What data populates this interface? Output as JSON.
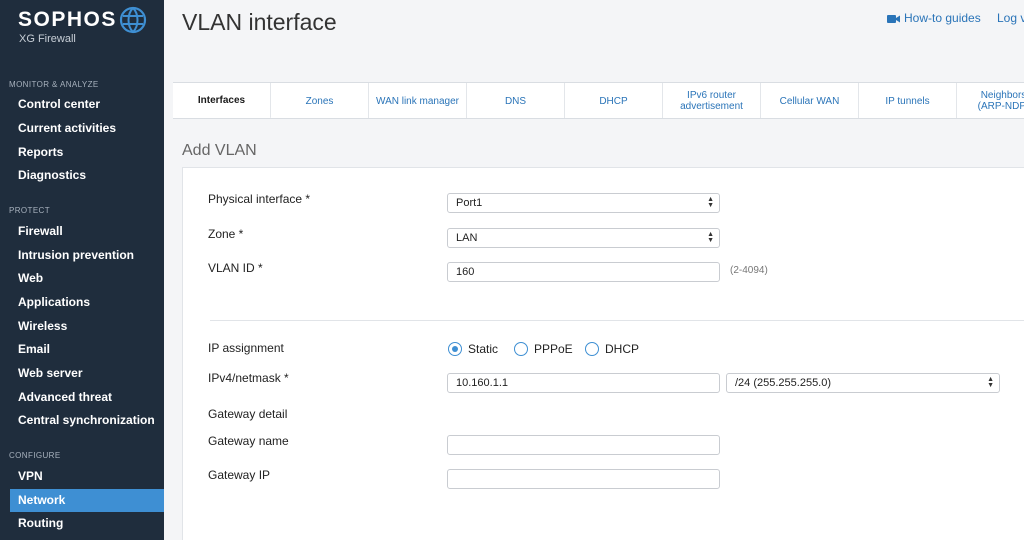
{
  "brand": {
    "name": "SOPHOS",
    "product": "XG Firewall"
  },
  "sidebar": {
    "sections": [
      {
        "title": "MONITOR & ANALYZE",
        "items": [
          "Control center",
          "Current activities",
          "Reports",
          "Diagnostics"
        ]
      },
      {
        "title": "PROTECT",
        "items": [
          "Firewall",
          "Intrusion prevention",
          "Web",
          "Applications",
          "Wireless",
          "Email",
          "Web server",
          "Advanced threat",
          "Central synchronization"
        ]
      },
      {
        "title": "CONFIGURE",
        "items": [
          "VPN",
          "Network",
          "Routing"
        ]
      }
    ],
    "active_item": "Network"
  },
  "header": {
    "title": "VLAN interface",
    "howto": "How-to guides",
    "log": "Log v"
  },
  "tabs": [
    {
      "label": "Interfaces",
      "active": true
    },
    {
      "label": "Zones"
    },
    {
      "label": "WAN link manager"
    },
    {
      "label": "DNS"
    },
    {
      "label": "DHCP"
    },
    {
      "label": "IPv6 router advertisement"
    },
    {
      "label": "Cellular WAN"
    },
    {
      "label": "IP tunnels"
    },
    {
      "label": "Neighbors (ARP-NDP)"
    }
  ],
  "form": {
    "section_title": "Add VLAN",
    "physical_interface": {
      "label": "Physical interface *",
      "value": "Port1"
    },
    "zone": {
      "label": "Zone *",
      "value": "LAN"
    },
    "vlan_id": {
      "label": "VLAN ID *",
      "value": "160",
      "hint": "(2-4094)"
    },
    "ip_assignment": {
      "label": "IP assignment",
      "options": [
        "Static",
        "PPPoE",
        "DHCP"
      ],
      "selected": "Static"
    },
    "ipv4": {
      "label": "IPv4/netmask *",
      "value": "10.160.1.1",
      "netmask": "/24 (255.255.255.0)"
    },
    "gateway_detail": {
      "label": "Gateway detail"
    },
    "gateway_name": {
      "label": "Gateway name",
      "value": ""
    },
    "gateway_ip": {
      "label": "Gateway IP",
      "value": ""
    }
  },
  "colors": {
    "sidebar_bg": "#1f2d3d",
    "accent": "#3e8fd3",
    "link": "#2a74b8"
  }
}
